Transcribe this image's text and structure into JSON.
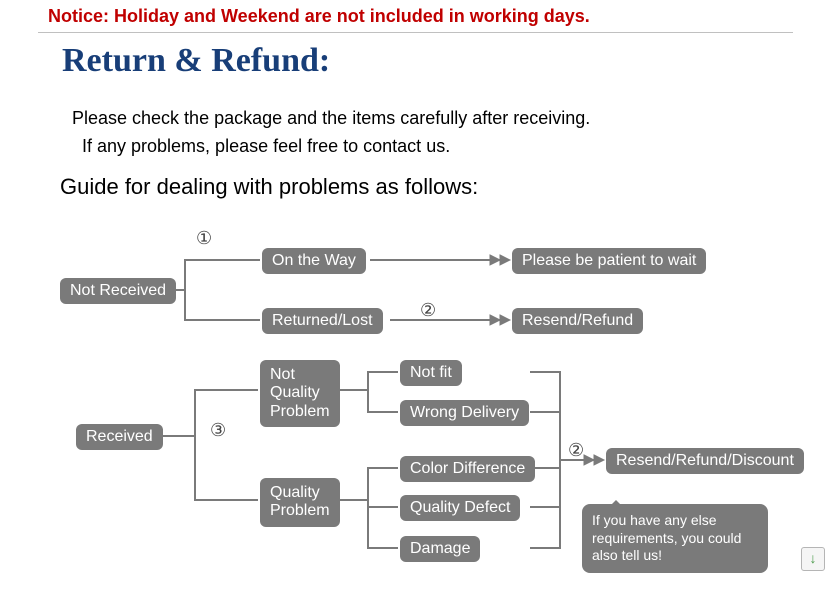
{
  "notice": "Notice: Holiday and Weekend are not included in working days.",
  "title": "Return & Refund:",
  "intro": {
    "line1": "Please check the package and the items carefully after receiving.",
    "line2": "If any problems, please feel free to contact us."
  },
  "guide_heading": "Guide for dealing with problems as follows:",
  "markers": {
    "m1": "①",
    "m2a": "②",
    "m2b": "②",
    "m3": "③"
  },
  "nodes": {
    "not_received": "Not Received",
    "on_the_way": "On the Way",
    "returned_lost": "Returned/Lost",
    "patient": "Please be patient to wait",
    "resend_refund": "Resend/Refund",
    "received": "Received",
    "not_quality": "Not\nQuality\nProblem",
    "quality": "Quality\nProblem",
    "not_fit": "Not fit",
    "wrong_delivery": "Wrong Delivery",
    "color_diff": "Color Difference",
    "quality_defect": "Quality Defect",
    "damage": "Damage",
    "rrd": "Resend/Refund/Discount"
  },
  "speech": "If you have any else\nrequirements, you could\nalso tell us!",
  "scroll_glyph": "↓"
}
